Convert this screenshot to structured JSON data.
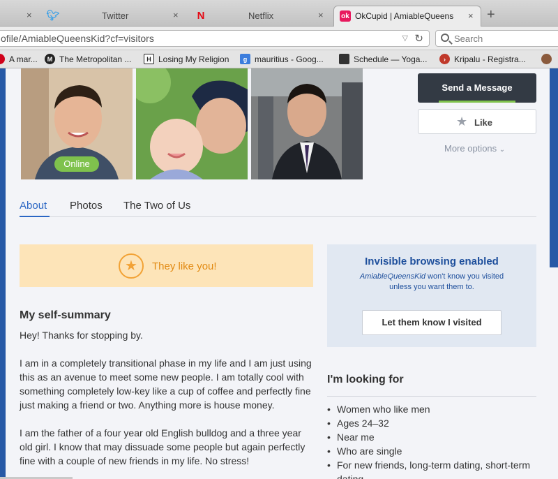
{
  "browser": {
    "tabs": [
      {
        "title": "",
        "close": "×",
        "icon": "generic"
      },
      {
        "title": "Twitter",
        "close": "×",
        "icon": "twitter-bird"
      },
      {
        "title": "Netflix",
        "close": "×",
        "icon": "netflix-n"
      },
      {
        "title": "OkCupid | AmiableQueens",
        "close": "×",
        "icon": "okcupid-ok",
        "active": true
      }
    ],
    "newtab": "+",
    "url": "ofile/AmiableQueensKid?cf=visitors",
    "search_placeholder": "Search",
    "bookmarks": [
      {
        "label": "A mar...",
        "icon_color": "#d0021b"
      },
      {
        "label": "The Metropolitan ...",
        "icon_color": "#222222",
        "glyph": "M"
      },
      {
        "label": "Losing My Religion",
        "icon_color": "#222222",
        "glyph": "H"
      },
      {
        "label": "mauritius - Goog...",
        "icon_color": "#3b7ddd",
        "glyph": "g"
      },
      {
        "label": "Schedule — Yoga...",
        "icon_color": "#333333"
      },
      {
        "label": "Kripalu - Registra...",
        "icon_color": "#c0392b"
      }
    ]
  },
  "profile": {
    "online_label": "Online",
    "send_message": "Send a Message",
    "like": "Like",
    "more_options": "More options",
    "tabs": [
      "About",
      "Photos",
      "The Two of Us"
    ],
    "they_like_you": "They like you!",
    "invisible": {
      "title": "Invisible browsing enabled",
      "username": "AmiableQueensKid",
      "line1_rest": " won't know you visited",
      "line2": "unless you want them to.",
      "button": "Let them know I visited"
    },
    "summary": {
      "heading": "My self-summary",
      "p1": "Hey! Thanks for stopping by.",
      "p2": "I am in a completely transitional phase in my life and I am just using this as an avenue to meet some new people. I am totally cool with something completely low-key like a cup of coffee and perfectly fine just making a friend or two. Anything more is house money.",
      "p3": "I am the father of a four year old English bulldog and a three year old girl. I know that may dissuade some people but again perfectly fine with a couple of new friends in my life. No stress!"
    },
    "looking_for": {
      "heading": "I'm looking for",
      "items": [
        "Women who like men",
        "Ages 24–32",
        "Near me",
        "Who are single",
        "For new friends, long-term dating, short-term dating"
      ]
    }
  },
  "colors": {
    "accent": "#2a66c4",
    "online": "#7fc24d",
    "like_you_bg": "#fde4b8",
    "like_you_text": "#e28a12",
    "invisible_bg": "#e1e8f2"
  }
}
